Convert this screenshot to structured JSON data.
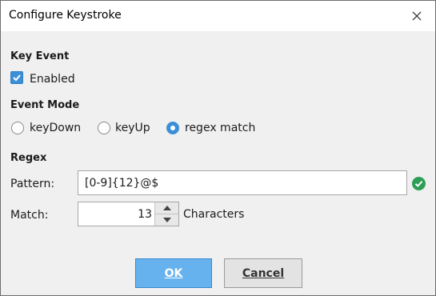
{
  "window": {
    "title": "Configure Keystroke"
  },
  "key_event": {
    "heading": "Key Event",
    "enabled_label": "Enabled",
    "enabled_checked": true
  },
  "event_mode": {
    "heading": "Event Mode",
    "options": [
      {
        "label": "keyDown",
        "selected": false
      },
      {
        "label": "keyUp",
        "selected": false
      },
      {
        "label": "regex match",
        "selected": true
      }
    ]
  },
  "regex": {
    "heading": "Regex",
    "pattern_label": "Pattern:",
    "pattern_value": "[0-9]{12}@$",
    "match_label": "Match:",
    "match_value": "13",
    "match_unit": "Characters"
  },
  "buttons": {
    "ok": "OK",
    "cancel": "Cancel"
  },
  "colors": {
    "accent": "#3c8fd6",
    "ok_button": "#66b2ef",
    "valid_green": "#2e9e57"
  },
  "icons": {
    "close": "close-icon",
    "check": "checkmark-icon",
    "valid": "check-circle-icon",
    "up": "chevron-up-icon",
    "down": "chevron-down-icon"
  }
}
